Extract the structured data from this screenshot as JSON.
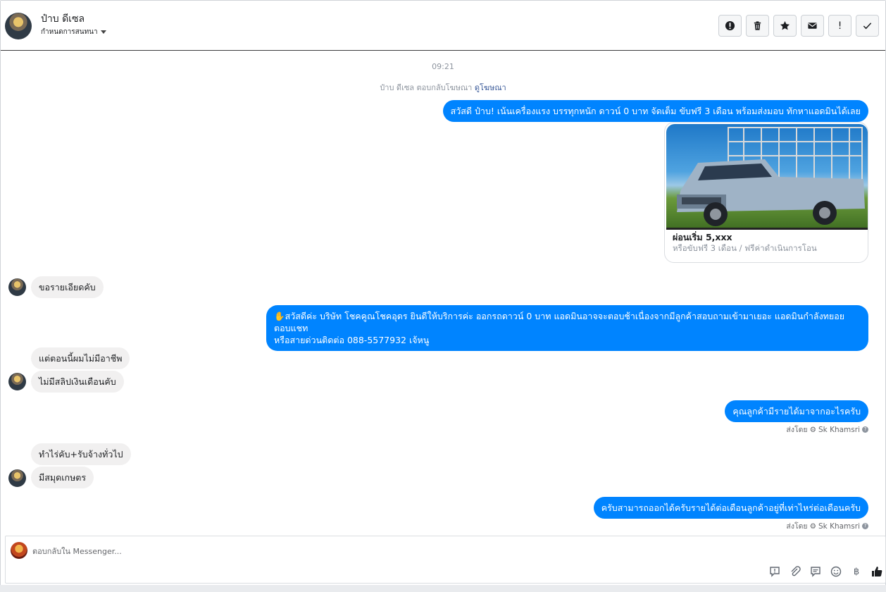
{
  "header": {
    "contact_name": "ป๋าบ ดีเซล",
    "subtitle": "กำหนดการสนทนา",
    "actions": [
      {
        "icon": "exclamation-circle-icon"
      },
      {
        "icon": "trash-icon"
      },
      {
        "icon": "star-icon"
      },
      {
        "icon": "envelope-icon"
      },
      {
        "icon": "exclamation-icon",
        "glyph": "!"
      },
      {
        "icon": "checkmark-icon"
      }
    ]
  },
  "thread": {
    "timestamp": "09:21",
    "ad_reply_prefix": "ป๋าบ ดีเซล ตอบกลับโฆษณา",
    "ad_reply_link": "ดูโฆษณา",
    "messages": [
      {
        "dir": "out",
        "text": "สวัสดี ป๋าบ! เน้นเครื่องแรง บรรทุกหนัก ดาวน์ 0 บาท จัดเต็ม ขับฟรี 3 เดือน พร้อมส่งมอบ ทักหาแอดมินได้เลย"
      },
      {
        "dir": "card",
        "title": "ผ่อนเริ่ม 5,xxx",
        "subtitle": "หรือขับฟรี 3 เดือน / ฟรีค่าดำเนินการโอน",
        "image": "pickup-truck-photo"
      },
      {
        "dir": "in",
        "text": "ขอรายเอียดคับ"
      },
      {
        "dir": "out",
        "lines": [
          "✋สวัสดีค่ะ บริษัท โชคคูณโชคอุดร ยินดีให้บริการค่ะ ออกรถดาวน์ 0 บาท แอดมินอาจจะตอบช้าเนื่องจากมีลูกค้าสอบถามเข้ามาเยอะ แอดมินกำลังทยอยตอบแชท",
          "หรือสายด่วนติดต่อ 088-5577932 เจ้หนู"
        ]
      },
      {
        "dir": "in",
        "text": "แต่ตอนนี้ผมไม่มีอาชีพ"
      },
      {
        "dir": "in",
        "text": "ไม่มีสลิปเงินเดือนคับ"
      },
      {
        "dir": "out",
        "text": "คุณลูกค้ามีรายได้มาจากอะไรครับ",
        "sent_by": "ส่งโดย",
        "sender": "Sk Khamsri"
      },
      {
        "dir": "in",
        "text": "ทำไร่คับ+รับจ้างทั่วไป"
      },
      {
        "dir": "in",
        "text": "มีสมุดเกษตร"
      },
      {
        "dir": "out",
        "text": "ครับสามารถออกได้ครับรายได้ต่อเดือนลูกค้าอยู่ที่เท่าไหร่ต่อเดือนครับ",
        "sent_by": "ส่งโดย",
        "sender": "Sk Khamsri"
      }
    ]
  },
  "composer": {
    "placeholder": "ตอบกลับใน Messenger...",
    "tools": [
      "saved-reply-icon",
      "attachment-icon",
      "chat-bubble-icon",
      "emoji-icon",
      "baht-icon",
      "thumbs-up-icon"
    ],
    "baht_glyph": "฿"
  },
  "colors": {
    "accent": "#0084ff",
    "incoming_bubble": "#f1f0f0",
    "muted": "#8d949e",
    "link": "#385898"
  }
}
